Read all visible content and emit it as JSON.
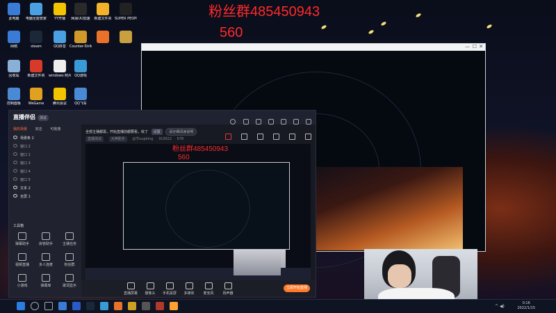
{
  "overlay_text": {
    "line1": "粉丝群485450943",
    "line2": "560"
  },
  "desktop_icons": [
    {
      "label": "此电脑",
      "color": "#3a7bd5"
    },
    {
      "label": "电脑全能管家",
      "color": "#4aa0e0"
    },
    {
      "label": "YY开播",
      "color": "#f2c400"
    },
    {
      "label": "网易UU加速",
      "color": "#2a2a2a"
    },
    {
      "label": "新建文件夹",
      "color": "#f2b22a"
    },
    {
      "label": "SUPER PEOPLE CBT",
      "color": "#222"
    },
    {
      "label": "网络",
      "color": "#3a7bd5"
    },
    {
      "label": "steam",
      "color": "#1b2838"
    },
    {
      "label": "QQ拼音",
      "color": "#4aa0e0"
    },
    {
      "label": "Counter-Strike Global Off...",
      "color": "#d09a2a"
    },
    {
      "label": "",
      "color": "#e8722a"
    },
    {
      "label": "",
      "color": "#c8a040"
    },
    {
      "label": "回收站",
      "color": "#8ab0d8"
    },
    {
      "label": "新建文件夹",
      "color": "#d83a2a"
    },
    {
      "label": "windows 照片查看器",
      "color": "#eee"
    },
    {
      "label": "QQ游戏",
      "color": "#3a9ad5"
    },
    {
      "label": "控制面板",
      "color": "#4a8ad5"
    },
    {
      "label": "WeGame",
      "color": "#e0a020"
    },
    {
      "label": "腾讯会议",
      "color": "#f2c400"
    },
    {
      "label": "QQ飞车",
      "color": "#4a8ad5"
    }
  ],
  "app": {
    "logo": "直播伴侣",
    "logo_tag": "测试",
    "tabs": [
      "我的场景",
      "双击",
      "可拖拽"
    ],
    "scenes": [
      {
        "label": "场景条 2",
        "on": true
      },
      {
        "label": "窗口 2",
        "on": false
      },
      {
        "label": "窗口 1",
        "on": false
      },
      {
        "label": "窗口 3",
        "on": false
      },
      {
        "label": "窗口 4",
        "on": false
      },
      {
        "label": "窗口 5",
        "on": false
      },
      {
        "label": "文本 2",
        "on": true
      },
      {
        "label": "全屏 1",
        "on": true
      }
    ],
    "toolbox_title": "工具箱",
    "tools": [
      "弹幕助手",
      "房管助手",
      "主播任务",
      "视频直播",
      "多人连麦",
      "粉丝群",
      "小游戏",
      "弹幕库",
      "歌词显示"
    ],
    "notice": "全部主播都需，开始直播前都要看，收了",
    "notice_btn": "设置",
    "notice_edit": "请仔细阅读说明",
    "meta": {
      "room": "直播测试",
      "cat": "大神助手",
      "id": "@守uupking",
      "num": "310022",
      "fans": "678"
    },
    "preview_text": {
      "line1": "粉丝群485450943",
      "line2": "560"
    },
    "controls": [
      "直播屏幕",
      "摄像头",
      "手机投屏",
      "多媒体",
      "麦克风",
      "扬声器"
    ],
    "go_live": "立即开始直播"
  },
  "right_panel_values": [
    "",
    "",
    "",
    "",
    "",
    "",
    "",
    "16",
    "18",
    "20",
    "",
    "",
    "",
    "",
    "",
    "",
    "",
    "",
    "",
    ""
  ],
  "clock": {
    "time": "0:16",
    "date": "2022/1/15"
  }
}
